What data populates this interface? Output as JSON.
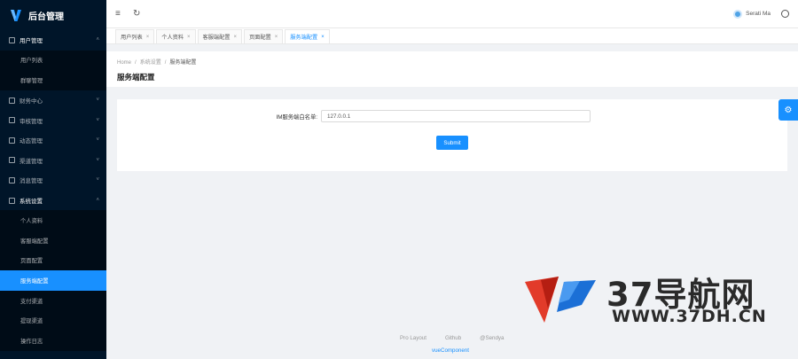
{
  "app": {
    "title": "后台管理"
  },
  "sidebar": {
    "menus": [
      {
        "label": "用户管理",
        "icon": "table-icon",
        "open": true,
        "children": [
          "用户列表",
          "群聊管理"
        ]
      },
      {
        "label": "财务中心",
        "icon": "finance-icon",
        "open": false
      },
      {
        "label": "审核管理",
        "icon": "audit-icon",
        "open": false
      },
      {
        "label": "动态管理",
        "icon": "feed-icon",
        "open": false
      },
      {
        "label": "渠道管理",
        "icon": "channel-icon",
        "open": false
      },
      {
        "label": "消息管理",
        "icon": "message-icon",
        "open": false
      },
      {
        "label": "系统设置",
        "icon": "gear-icon",
        "open": true,
        "children": [
          "个人资料",
          "客服端配置",
          "页面配置",
          "服务端配置",
          "支付渠道",
          "提现渠道",
          "操作日志"
        ]
      }
    ],
    "active_item": "服务端配置"
  },
  "header": {
    "user_name": "Serati Ma"
  },
  "tabs": [
    {
      "label": "用户列表",
      "active": false
    },
    {
      "label": "个人资料",
      "active": false
    },
    {
      "label": "客服端配置",
      "active": false
    },
    {
      "label": "页面配置",
      "active": false
    },
    {
      "label": "服务端配置",
      "active": true
    }
  ],
  "breadcrumb": [
    "Home",
    "系统设置",
    "服务端配置"
  ],
  "page": {
    "title": "服务端配置"
  },
  "form": {
    "label": "IM服务端白名单:",
    "value": "127.0.0.1",
    "submit_label": "Submit"
  },
  "footer": {
    "links": [
      "Pro Layout",
      "Github",
      "@Sendya"
    ],
    "copyright": "vueComponent"
  },
  "watermark": {
    "big": "37导航网",
    "small": "WWW.37DH.CN"
  },
  "colors": {
    "primary": "#1890ff",
    "sidebar_bg": "#001529",
    "submenu_bg": "#000c17"
  }
}
